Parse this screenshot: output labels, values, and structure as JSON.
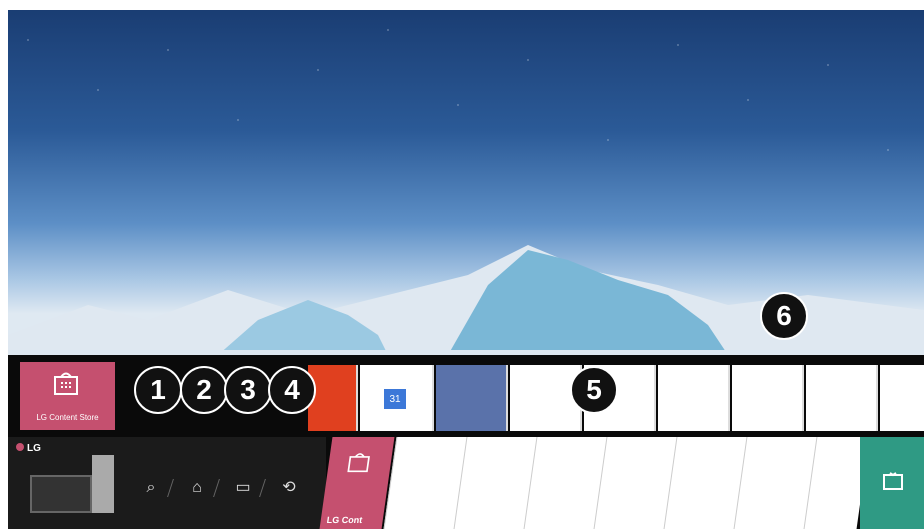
{
  "app": {
    "store_label_small": "LG Content Store",
    "store_label_big": "LG Cont",
    "brand": "LG"
  },
  "callouts": [
    "1",
    "2",
    "3",
    "4",
    "5",
    "6"
  ],
  "controls": [
    {
      "name": "search-icon",
      "glyph": "⌕"
    },
    {
      "name": "home-dashboard-icon",
      "glyph": "⌂"
    },
    {
      "name": "input-icon",
      "glyph": "▭"
    },
    {
      "name": "recent-icon",
      "glyph": "⟲"
    }
  ],
  "app_tiles": [
    {
      "name": "calendar-tile",
      "text": "31"
    },
    {
      "name": "blue-tile",
      "text": ""
    }
  ]
}
